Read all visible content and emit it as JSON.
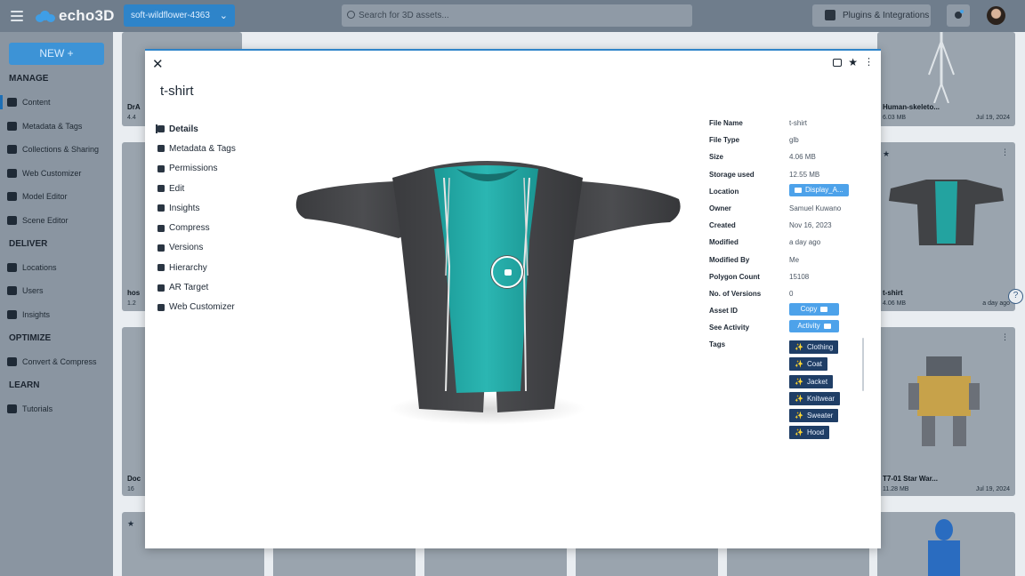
{
  "app": {
    "name": "echo3D",
    "project": "soft-wildflower-4363"
  },
  "search": {
    "placeholder": "Search for 3D assets..."
  },
  "header": {
    "plugins_label": "Plugins & Integrations"
  },
  "sidebar": {
    "new_label": "NEW +",
    "sections": [
      {
        "title": "MANAGE",
        "items": [
          {
            "label": "Content",
            "icon": "cube-icon"
          },
          {
            "label": "Metadata & Tags",
            "icon": "tag-icon"
          },
          {
            "label": "Collections & Sharing",
            "icon": "grid-icon"
          },
          {
            "label": "Web Customizer",
            "icon": "vr-icon"
          },
          {
            "label": "Model Editor",
            "icon": "pencil-icon"
          },
          {
            "label": "Scene Editor",
            "icon": "globe-icon"
          }
        ]
      },
      {
        "title": "DELIVER",
        "items": [
          {
            "label": "Locations",
            "icon": "location-icon"
          },
          {
            "label": "Users",
            "icon": "user-icon"
          },
          {
            "label": "Insights",
            "icon": "chart-icon"
          }
        ]
      },
      {
        "title": "OPTIMIZE",
        "items": [
          {
            "label": "Convert & Compress",
            "icon": "convert-icon"
          }
        ]
      },
      {
        "title": "LEARN",
        "items": [
          {
            "label": "Tutorials",
            "icon": "tutorial-icon"
          }
        ]
      }
    ]
  },
  "background_cards": [
    {
      "title": "Human-skeleto...",
      "size": "6.03 MB",
      "date": "Jul 19, 2024"
    },
    {
      "title": "t-shirt",
      "size": "4.06 MB",
      "date": "a day ago"
    },
    {
      "title": "T7-01 Star War...",
      "size": "11.28 MB",
      "date": "Jul 19, 2024"
    },
    {
      "title": "DrA",
      "size": "4.4"
    },
    {
      "title": "hos",
      "size": "1.2"
    },
    {
      "title": "Doc",
      "size": "16"
    }
  ],
  "modal": {
    "title": "t-shirt",
    "close": "✕",
    "menu": [
      {
        "label": "Details",
        "icon": "cube-icon"
      },
      {
        "label": "Metadata & Tags",
        "icon": "tag-icon"
      },
      {
        "label": "Permissions",
        "icon": "user-plus-icon"
      },
      {
        "label": "Edit",
        "icon": "pencil-icon"
      },
      {
        "label": "Insights",
        "icon": "chart-icon"
      },
      {
        "label": "Compress",
        "icon": "compress-icon"
      },
      {
        "label": "Versions",
        "icon": "versions-icon"
      },
      {
        "label": "Hierarchy",
        "icon": "hierarchy-icon"
      },
      {
        "label": "AR Target",
        "icon": "target-icon"
      },
      {
        "label": "Web Customizer",
        "icon": "vr-icon"
      }
    ],
    "details": [
      {
        "key": "File Name",
        "value": "t-shirt"
      },
      {
        "key": "File Type",
        "value": "glb"
      },
      {
        "key": "Size",
        "value": "4.06 MB"
      },
      {
        "key": "Storage used",
        "value": "12.55 MB"
      },
      {
        "key": "Location",
        "value": "Display_A..."
      },
      {
        "key": "Owner",
        "value": "Samuel Kuwano"
      },
      {
        "key": "Created",
        "value": "Nov 16, 2023"
      },
      {
        "key": "Modified",
        "value": "a day ago"
      },
      {
        "key": "Modified By",
        "value": "Me"
      },
      {
        "key": "Polygon Count",
        "value": "15108"
      },
      {
        "key": "No. of Versions",
        "value": "0"
      },
      {
        "key": "Asset ID",
        "value": "Copy"
      },
      {
        "key": "See Activity",
        "value": "Activity"
      },
      {
        "key": "Tags",
        "value": ""
      }
    ],
    "tags": [
      "Clothing",
      "Coat",
      "Jacket",
      "Knitwear",
      "Sweater",
      "Hood"
    ]
  },
  "colors": {
    "accent": "#2e84c9",
    "tag_bg": "#1f3e66",
    "pill_bg": "#4da2ea",
    "teal_shirt": "#1fa7a3",
    "hoodie": "#3a3a3d"
  },
  "help": "?"
}
